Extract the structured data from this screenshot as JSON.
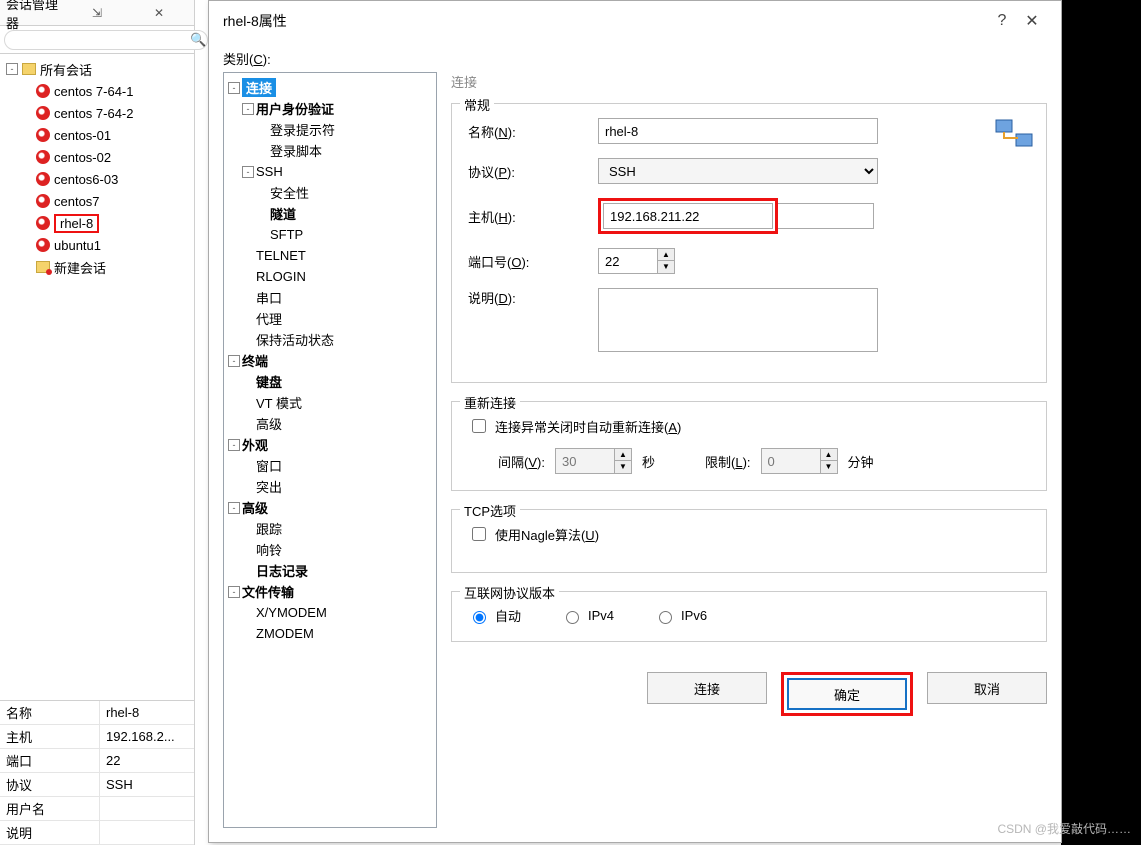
{
  "sessionManager": {
    "title": "会话管理器",
    "searchPlaceholder": "",
    "root": "所有会话",
    "sessions": [
      "centos 7-64-1",
      "centos 7-64-2",
      "centos-01",
      "centos-02",
      "centos6-03",
      "centos7",
      "rhel-8",
      "ubuntu1"
    ],
    "newSession": "新建会话",
    "props": {
      "nameLabel": "名称",
      "nameValue": "rhel-8",
      "hostLabel": "主机",
      "hostValue": "192.168.2...",
      "portLabel": "端口",
      "portValue": "22",
      "protoLabel": "协议",
      "protoValue": "SSH",
      "userLabel": "用户名",
      "userValue": "",
      "descLabel": "说明",
      "descValue": ""
    }
  },
  "dialog": {
    "title": "rhel-8属性",
    "help": "?",
    "close": "✕",
    "categoryLabelPrefix": "类别(",
    "categoryKey": "C",
    "categoryLabelSuffix": "):",
    "tree": {
      "connection": "连接",
      "userAuth": "用户身份验证",
      "loginPrompt": "登录提示符",
      "loginScript": "登录脚本",
      "ssh": "SSH",
      "security": "安全性",
      "tunnel": "隧道",
      "sftp": "SFTP",
      "telnet": "TELNET",
      "rlogin": "RLOGIN",
      "serial": "串口",
      "proxy": "代理",
      "keepalive": "保持活动状态",
      "terminal": "终端",
      "keyboard": "键盘",
      "vtmode": "VT 模式",
      "advanced1": "高级",
      "appearance": "外观",
      "window": "窗口",
      "highlight": "突出",
      "advanced2": "高级",
      "trace": "跟踪",
      "bell": "响铃",
      "log": "日志记录",
      "filetransfer": "文件传输",
      "xymodem": "X/YMODEM",
      "zmodem": "ZMODEM"
    },
    "form": {
      "sectionTitle": "连接",
      "general": "常规",
      "nameLabelPre": "名称(",
      "nameKey": "N",
      "nameLabelPost": "):",
      "nameValue": "rhel-8",
      "protoLabelPre": "协议(",
      "protoKey": "P",
      "protoLabelPost": "):",
      "protoValue": "SSH",
      "hostLabelPre": "主机(",
      "hostKey": "H",
      "hostLabelPost": "):",
      "hostValue": "192.168.211.22",
      "portLabelPre": "端口号(",
      "portKey": "O",
      "portLabelPost": "):",
      "portValue": "22",
      "descLabelPre": "说明(",
      "descKey": "D",
      "descLabelPost": "):",
      "descValue": "",
      "reconnect": "重新连接",
      "reconnectChkPre": "连接异常关闭时自动重新连接(",
      "reconnectKey": "A",
      "reconnectChkPost": ")",
      "intervalPre": "间隔(",
      "intervalKey": "V",
      "intervalPost": "):",
      "intervalValue": "30",
      "sec": "秒",
      "limitPre": "限制(",
      "limitKey": "L",
      "limitPost": "):",
      "limitValue": "0",
      "min": "分钟",
      "tcp": "TCP选项",
      "naglePre": "使用Nagle算法(",
      "nagleKey": "U",
      "naglePost": ")",
      "ipver": "互联网协议版本",
      "auto": "自动",
      "ipv4": "IPv4",
      "ipv6": "IPv6"
    },
    "buttons": {
      "connect": "连接",
      "ok": "确定",
      "cancel": "取消"
    }
  },
  "watermark": "CSDN @我爱敲代码……"
}
